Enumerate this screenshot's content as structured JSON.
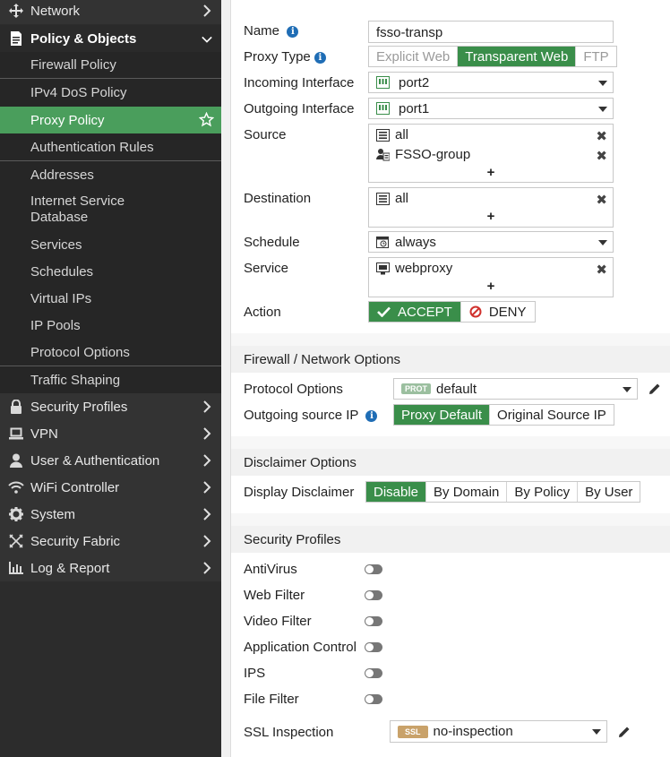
{
  "sidebar": {
    "top_items": [
      {
        "label": "Network",
        "icon": "network-icon"
      },
      {
        "label": "Policy & Objects",
        "icon": "policy-icon",
        "expanded": true
      },
      {
        "label": "Security Profiles",
        "icon": "lock-icon"
      },
      {
        "label": "VPN",
        "icon": "laptop-icon"
      },
      {
        "label": "User & Authentication",
        "icon": "user-icon"
      },
      {
        "label": "WiFi Controller",
        "icon": "wifi-icon"
      },
      {
        "label": "System",
        "icon": "gear-icon"
      },
      {
        "label": "Security Fabric",
        "icon": "fabric-icon"
      },
      {
        "label": "Log & Report",
        "icon": "chart-icon"
      }
    ],
    "sub_items": [
      {
        "label": "Firewall Policy"
      },
      {
        "label": "IPv4 DoS Policy"
      },
      {
        "label": "Proxy Policy",
        "active": true
      },
      {
        "label": "Authentication Rules"
      },
      {
        "label": "Addresses"
      },
      {
        "label": "Internet Service Database"
      },
      {
        "label": "Services"
      },
      {
        "label": "Schedules"
      },
      {
        "label": "Virtual IPs"
      },
      {
        "label": "IP Pools"
      },
      {
        "label": "Protocol Options"
      },
      {
        "label": "Traffic Shaping"
      }
    ]
  },
  "form": {
    "name_label": "Name",
    "name_value": "fsso-transp",
    "proxy_type_label": "Proxy Type",
    "proxy_types": [
      "Explicit Web",
      "Transparent Web",
      "FTP"
    ],
    "proxy_type_selected": "Transparent Web",
    "incoming_label": "Incoming Interface",
    "incoming_value": "port2",
    "outgoing_label": "Outgoing Interface",
    "outgoing_value": "port1",
    "source_label": "Source",
    "source_items": [
      "all",
      "FSSO-group"
    ],
    "destination_label": "Destination",
    "destination_items": [
      "all"
    ],
    "schedule_label": "Schedule",
    "schedule_value": "always",
    "service_label": "Service",
    "service_items": [
      "webproxy"
    ],
    "action_label": "Action",
    "action_accept": "ACCEPT",
    "action_deny": "DENY",
    "plus": "+",
    "remove": "✖"
  },
  "firewall_options": {
    "header": "Firewall / Network Options",
    "protocol_label": "Protocol Options",
    "protocol_tag": "PROT",
    "protocol_value": "default",
    "outgoing_ip_label": "Outgoing source IP",
    "outgoing_ip_options": [
      "Proxy Default",
      "Original Source IP"
    ],
    "outgoing_ip_selected": "Proxy Default"
  },
  "disclaimer": {
    "header": "Disclaimer Options",
    "label": "Display Disclaimer",
    "options": [
      "Disable",
      "By Domain",
      "By Policy",
      "By User"
    ],
    "selected": "Disable"
  },
  "security_profiles": {
    "header": "Security Profiles",
    "items": [
      "AntiVirus",
      "Web Filter",
      "Video Filter",
      "Application Control",
      "IPS",
      "File Filter"
    ],
    "ssl_label": "SSL Inspection",
    "ssl_tag": "SSL",
    "ssl_value": "no-inspection"
  },
  "colors": {
    "accent_green": "#3a8e4a",
    "sidebar_bg": "#2c2c2c",
    "active_bg": "#4a9e5c",
    "deny_red": "#d0312d"
  }
}
